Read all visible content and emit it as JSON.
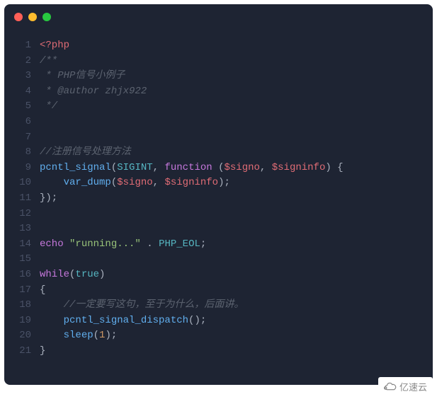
{
  "window": {
    "traffic_lights": [
      "red",
      "yellow",
      "green"
    ]
  },
  "code": {
    "lines": [
      {
        "n": 1,
        "tokens": [
          {
            "t": "<?php",
            "c": "tag"
          }
        ]
      },
      {
        "n": 2,
        "tokens": [
          {
            "t": "/**",
            "c": "comment"
          }
        ]
      },
      {
        "n": 3,
        "tokens": [
          {
            "t": " * PHP信号小例子",
            "c": "comment"
          }
        ]
      },
      {
        "n": 4,
        "tokens": [
          {
            "t": " * @author zhjx922",
            "c": "comment"
          }
        ]
      },
      {
        "n": 5,
        "tokens": [
          {
            "t": " */",
            "c": "comment"
          }
        ]
      },
      {
        "n": 6,
        "tokens": []
      },
      {
        "n": 7,
        "tokens": []
      },
      {
        "n": 8,
        "tokens": [
          {
            "t": "//注册信号处理方法",
            "c": "comment"
          }
        ]
      },
      {
        "n": 9,
        "tokens": [
          {
            "t": "pcntl_signal",
            "c": "func"
          },
          {
            "t": "(",
            "c": "punct"
          },
          {
            "t": "SIGINT",
            "c": "const"
          },
          {
            "t": ", ",
            "c": "punct"
          },
          {
            "t": "function",
            "c": "keyword"
          },
          {
            "t": " (",
            "c": "punct"
          },
          {
            "t": "$signo",
            "c": "var"
          },
          {
            "t": ", ",
            "c": "punct"
          },
          {
            "t": "$signinfo",
            "c": "var"
          },
          {
            "t": ") {",
            "c": "punct"
          }
        ]
      },
      {
        "n": 10,
        "tokens": [
          {
            "t": "    ",
            "c": "punct"
          },
          {
            "t": "var_dump",
            "c": "func"
          },
          {
            "t": "(",
            "c": "punct"
          },
          {
            "t": "$signo",
            "c": "var"
          },
          {
            "t": ", ",
            "c": "punct"
          },
          {
            "t": "$signinfo",
            "c": "var"
          },
          {
            "t": ");",
            "c": "punct"
          }
        ]
      },
      {
        "n": 11,
        "tokens": [
          {
            "t": "});",
            "c": "punct"
          }
        ]
      },
      {
        "n": 12,
        "tokens": []
      },
      {
        "n": 13,
        "tokens": []
      },
      {
        "n": 14,
        "tokens": [
          {
            "t": "echo",
            "c": "echo"
          },
          {
            "t": " ",
            "c": "punct"
          },
          {
            "t": "\"running...\"",
            "c": "string"
          },
          {
            "t": " . ",
            "c": "punct"
          },
          {
            "t": "PHP_EOL",
            "c": "const"
          },
          {
            "t": ";",
            "c": "punct"
          }
        ]
      },
      {
        "n": 15,
        "tokens": []
      },
      {
        "n": 16,
        "tokens": [
          {
            "t": "while",
            "c": "keyword"
          },
          {
            "t": "(",
            "c": "punct"
          },
          {
            "t": "true",
            "c": "const"
          },
          {
            "t": ")",
            "c": "punct"
          }
        ]
      },
      {
        "n": 17,
        "tokens": [
          {
            "t": "{",
            "c": "punct"
          }
        ]
      },
      {
        "n": 18,
        "tokens": [
          {
            "t": "    ",
            "c": "punct"
          },
          {
            "t": "//一定要写这句，至于为什么，后面讲。",
            "c": "comment"
          }
        ]
      },
      {
        "n": 19,
        "tokens": [
          {
            "t": "    ",
            "c": "punct"
          },
          {
            "t": "pcntl_signal_dispatch",
            "c": "func"
          },
          {
            "t": "();",
            "c": "punct"
          }
        ]
      },
      {
        "n": 20,
        "tokens": [
          {
            "t": "    ",
            "c": "punct"
          },
          {
            "t": "sleep",
            "c": "func"
          },
          {
            "t": "(",
            "c": "punct"
          },
          {
            "t": "1",
            "c": "number"
          },
          {
            "t": ");",
            "c": "punct"
          }
        ]
      },
      {
        "n": 21,
        "tokens": [
          {
            "t": "}",
            "c": "punct"
          }
        ]
      }
    ]
  },
  "watermark": {
    "text": "亿速云"
  }
}
